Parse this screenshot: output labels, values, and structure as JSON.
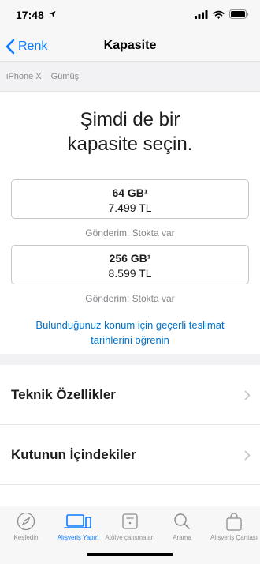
{
  "status": {
    "time": "17:48"
  },
  "nav": {
    "back_label": "Renk",
    "title": "Kapasite"
  },
  "breadcrumb": {
    "items": [
      "iPhone X",
      "Gümüş"
    ]
  },
  "main": {
    "headline_line1": "Şimdi de bir",
    "headline_line2": "kapasite seçin.",
    "options": [
      {
        "size": "64 GB¹",
        "price": "7.499 TL",
        "shipping": "Gönderim: Stokta var"
      },
      {
        "size": "256 GB¹",
        "price": "8.599 TL",
        "shipping": "Gönderim: Stokta var"
      }
    ],
    "delivery_link": "Bulunduğunuz konum için geçerli teslimat tarihlerini öğrenin"
  },
  "rows": [
    {
      "label": "Teknik Özellikler"
    },
    {
      "label": "Kutunun İçindekiler"
    }
  ],
  "tabs": [
    {
      "label": "Keşfedin",
      "icon": "compass-icon",
      "active": false
    },
    {
      "label": "Alışveriş Yapın",
      "icon": "devices-icon",
      "active": true
    },
    {
      "label": "Atölye çalışmaları",
      "icon": "calendar-icon",
      "active": false
    },
    {
      "label": "Arama",
      "icon": "search-icon",
      "active": false
    },
    {
      "label": "Alışveriş Çantası",
      "icon": "bag-icon",
      "active": false
    }
  ],
  "colors": {
    "accent": "#0a7aff",
    "link": "#0070c9",
    "secondary_text": "#86868b",
    "tab_inactive": "#8e8e93"
  }
}
